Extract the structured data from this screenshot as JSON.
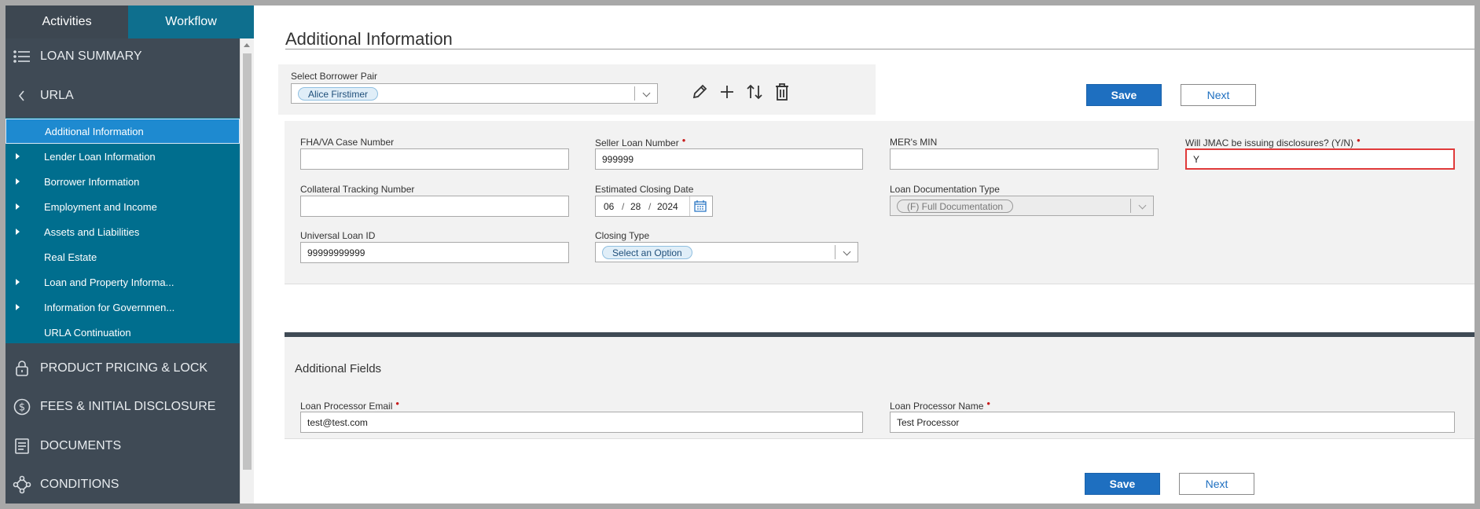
{
  "tabs": {
    "activities": "Activities",
    "workflow": "Workflow"
  },
  "sidebar": {
    "sections": [
      {
        "label": "LOAN SUMMARY",
        "icon": "list-icon"
      },
      {
        "label": "URLA",
        "icon": "chevron-left-icon"
      },
      {
        "label": "PRODUCT PRICING & LOCK",
        "icon": "lock-icon"
      },
      {
        "label": "FEES & INITIAL DISCLOSURE",
        "icon": "dollar-icon"
      },
      {
        "label": "DOCUMENTS",
        "icon": "document-icon"
      },
      {
        "label": "CONDITIONS",
        "icon": "conditions-icon"
      }
    ],
    "urla_items": [
      {
        "label": "Additional Information",
        "active": true,
        "expandable": false
      },
      {
        "label": "Lender Loan Information",
        "active": false,
        "expandable": true
      },
      {
        "label": "Borrower Information",
        "active": false,
        "expandable": true
      },
      {
        "label": "Employment and Income",
        "active": false,
        "expandable": true
      },
      {
        "label": "Assets and Liabilities",
        "active": false,
        "expandable": true
      },
      {
        "label": "Real Estate",
        "active": false,
        "expandable": false
      },
      {
        "label": "Loan and Property Informa...",
        "active": false,
        "expandable": true
      },
      {
        "label": "Information for Governmen...",
        "active": false,
        "expandable": true
      },
      {
        "label": "URLA Continuation",
        "active": false,
        "expandable": false
      }
    ]
  },
  "main": {
    "title": "Additional Information",
    "borrower_pair": {
      "label": "Select Borrower Pair",
      "value": "Alice Firstimer"
    },
    "buttons": {
      "save": "Save",
      "next": "Next"
    },
    "fields": {
      "fha_case": {
        "label": "FHA/VA Case Number",
        "value": ""
      },
      "seller_loan": {
        "label": "Seller Loan Number",
        "value": "999999"
      },
      "mers_min": {
        "label": "MER's MIN",
        "value": ""
      },
      "jmac_disclosures": {
        "label": "Will JMAC be issuing disclosures? (Y/N)",
        "value": "Y"
      },
      "collateral": {
        "label": "Collateral Tracking Number",
        "value": ""
      },
      "closing_date": {
        "label": "Estimated Closing Date",
        "month": "06",
        "sep": "/",
        "day": "28",
        "year": "2024"
      },
      "doc_type": {
        "label": "Loan Documentation Type",
        "value": "(F) Full Documentation"
      },
      "uli": {
        "label": "Universal Loan ID",
        "value": "99999999999"
      },
      "closing_type": {
        "label": "Closing Type",
        "value": "Select an Option"
      }
    },
    "additional_fields": {
      "title": "Additional Fields",
      "processor_email": {
        "label": "Loan Processor Email",
        "value": "test@test.com"
      },
      "processor_name": {
        "label": "Loan Processor Name",
        "value": "Test Processor"
      }
    }
  },
  "colors": {
    "sidebar": "#3f4a55",
    "workflow_tab": "#0e6f8e",
    "urla_submenu": "#006e8e",
    "active_item": "#1e8ad0",
    "primary_button": "#1e6fc0",
    "highlight_border": "#e03a3a"
  }
}
